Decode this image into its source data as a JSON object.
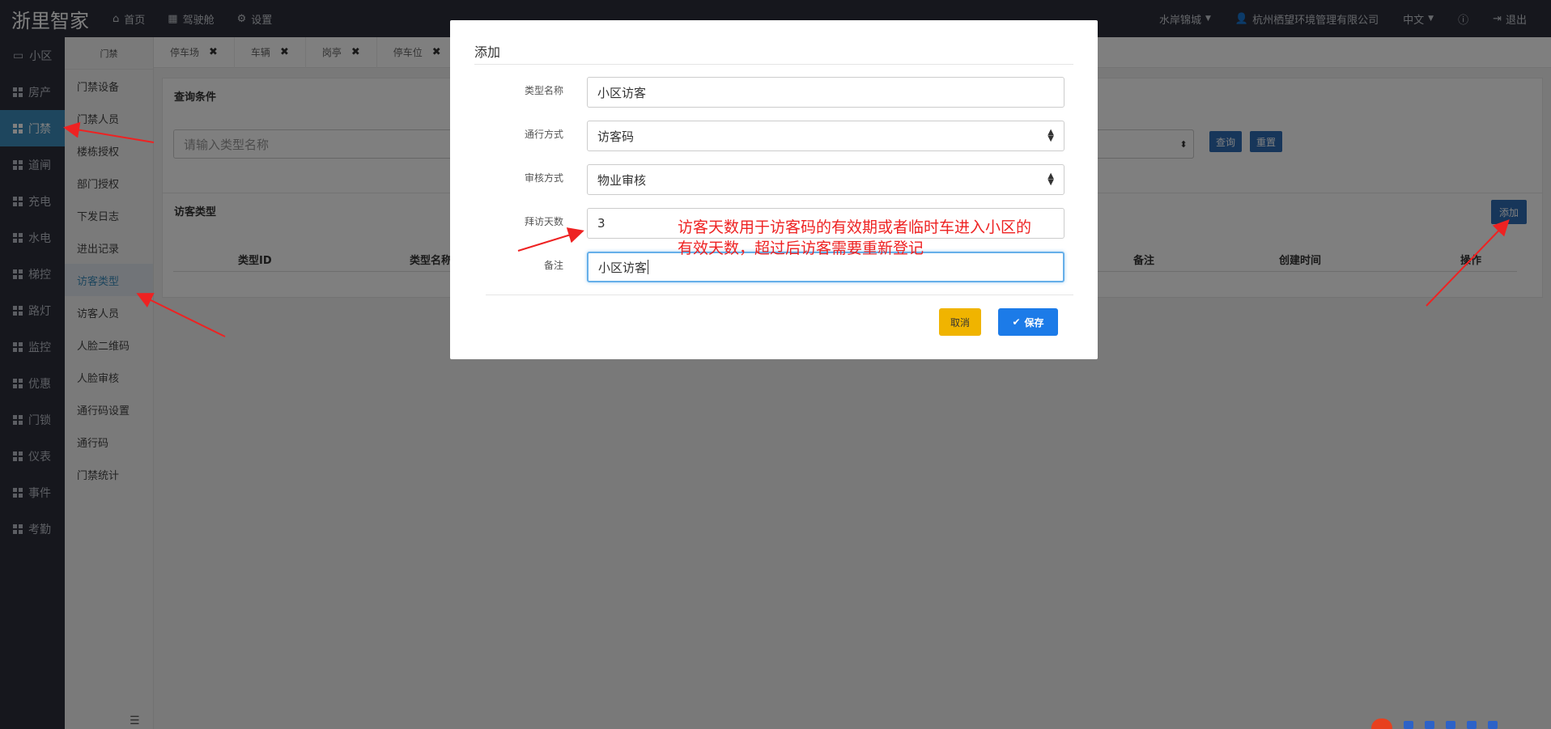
{
  "topbar": {
    "brand": "浙里智家",
    "nav": [
      {
        "label": "首页",
        "icon": "home-icon"
      },
      {
        "label": "驾驶舱",
        "icon": "calculator-icon"
      },
      {
        "label": "设置",
        "icon": "gear-icon"
      }
    ],
    "community": "水岸锦城",
    "company": "杭州栖望环境管理有限公司",
    "language": "中文",
    "help_icon": "help-icon",
    "logout": "退出"
  },
  "leftnav": {
    "items": [
      "小区",
      "房产",
      "门禁",
      "道闸",
      "充电",
      "水电",
      "梯控",
      "路灯",
      "监控",
      "优惠",
      "门锁",
      "仪表",
      "事件",
      "考勤"
    ],
    "active": "门禁"
  },
  "subnav": {
    "title": "门禁",
    "items": [
      "门禁设备",
      "门禁人员",
      "楼栋授权",
      "部门授权",
      "下发日志",
      "进出记录",
      "访客类型",
      "访客人员",
      "人脸二维码",
      "人脸审核",
      "通行码设置",
      "通行码",
      "门禁统计"
    ],
    "active": "访客类型"
  },
  "tabs": [
    "停车场",
    "车辆",
    "岗亭",
    "停车位"
  ],
  "query": {
    "title": "查询条件",
    "placeholder": "请输入类型名称",
    "search_button": "查询",
    "reset_button": "重置"
  },
  "list": {
    "title": "访客类型",
    "add_button": "添加",
    "columns": [
      "类型ID",
      "类型名称",
      "备注",
      "创建时间",
      "操作"
    ]
  },
  "modal": {
    "title": "添加",
    "fields": [
      {
        "label": "类型名称",
        "value": "小区访客",
        "type": "text"
      },
      {
        "label": "通行方式",
        "value": "访客码",
        "type": "select"
      },
      {
        "label": "审核方式",
        "value": "物业审核",
        "type": "select"
      },
      {
        "label": "拜访天数",
        "value": "3",
        "type": "text"
      },
      {
        "label": "备注",
        "value": "小区访客",
        "type": "text"
      }
    ],
    "cancel": "取消",
    "save": "保存"
  },
  "annotation": {
    "line1": "访客天数用于访客码的有效期或者临时车进入小区的",
    "line2": "有效天数，超过后访客需要重新登记",
    "color": "#ee2222"
  },
  "colors": {
    "topbar": "#2c2f3b",
    "accent": "#3c8dbc",
    "primary_button": "#1c7be8",
    "cancel_button": "#f0b400"
  }
}
